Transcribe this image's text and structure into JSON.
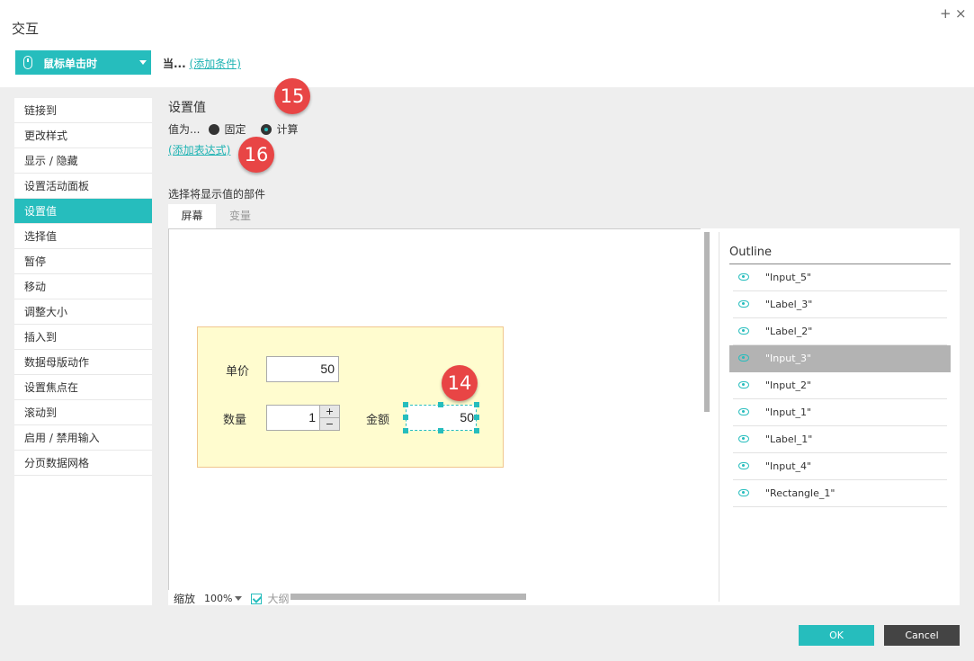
{
  "dialog": {
    "title": "交互",
    "plus_glyph": "+",
    "close_glyph": "×"
  },
  "trigger": {
    "label": "鼠标单击时",
    "icon": "mouse-icon"
  },
  "condition": {
    "prefix": "当...",
    "add_link": "(添加条件)"
  },
  "actions": [
    "链接到",
    "更改样式",
    "显示 / 隐藏",
    "设置活动面板",
    "设置值",
    "选择值",
    "暂停",
    "移动",
    "调整大小",
    "插入到",
    "数据母版动作",
    "设置焦点在",
    "滚动到",
    "启用 / 禁用输入",
    "分页数据网格"
  ],
  "active_action_index": 4,
  "section": {
    "title": "设置值",
    "value_prefix": "值为...",
    "option_fixed": "固定",
    "option_calc": "计算",
    "selected_option": "计算",
    "add_expression": "(添加表达式)",
    "choose_widget": "选择将显示值的部件"
  },
  "tabs": {
    "screen": "屏幕",
    "variables": "变量",
    "active": "屏幕"
  },
  "badges": {
    "b14": "14",
    "b15": "15",
    "b16": "16"
  },
  "form": {
    "unit_price_label": "单价",
    "unit_price_value": "50",
    "quantity_label": "数量",
    "quantity_value": "1",
    "stepper_plus": "+",
    "stepper_minus": "−",
    "amount_label": "金额",
    "amount_value": "50"
  },
  "zoom": {
    "label": "缩放",
    "value": "100%",
    "outline_checkbox": "大纲",
    "outline_checked": true
  },
  "outline": {
    "title": "Outline",
    "items": [
      "\"Input_5\"",
      "\"Label_3\"",
      "\"Label_2\"",
      "\"Input_3\"",
      "\"Input_2\"",
      "\"Input_1\"",
      "\"Label_1\"",
      "\"Input_4\"",
      "\"Rectangle_1\""
    ],
    "selected_index": 3
  },
  "buttons": {
    "ok": "OK",
    "cancel": "Cancel"
  },
  "colors": {
    "accent": "#26bdbd",
    "badge": "#e84545",
    "yellow_bg": "#fffccf",
    "selected_row": "#b3b3b3",
    "cancel_bg": "#444444"
  }
}
